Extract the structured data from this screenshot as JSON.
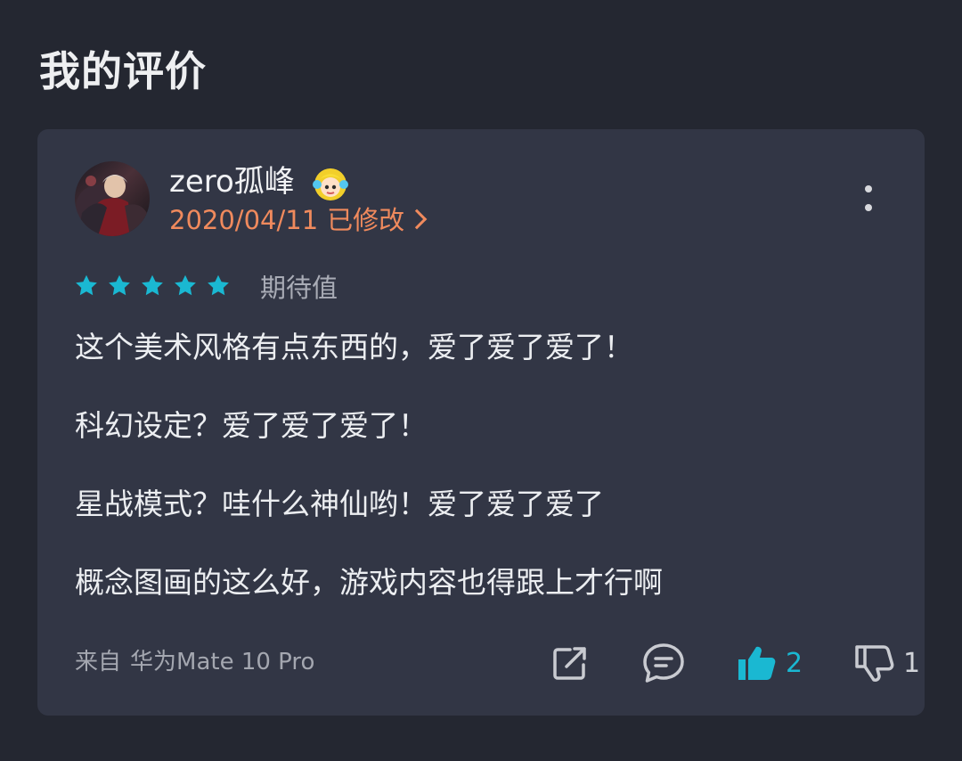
{
  "page": {
    "title": "我的评价"
  },
  "review": {
    "username": "zero孤峰",
    "date": "2020/04/11",
    "edited_label": "已修改",
    "rating_stars": 5,
    "rating_label": "期待值",
    "paragraphs": [
      "这个美术风格有点东西的，爱了爱了爱了！",
      "科幻设定？爱了爱了爱了！",
      "星战模式？哇什么神仙哟！爱了爱了爱了",
      "概念图画的这么好，游戏内容也得跟上才行啊"
    ],
    "device_prefix": "来自",
    "device_model": "华为Mate 10 Pro",
    "likes": "2",
    "dislikes": "1"
  },
  "icons": {
    "avatar": "avatar-image",
    "badge": "anime-girl-badge-icon",
    "chevron": "chevron-right-icon",
    "more": "more-vertical-icon",
    "star": "star-icon",
    "share": "share-icon",
    "comment": "comment-icon",
    "like": "thumbs-up-icon",
    "dislike": "thumbs-down-icon"
  },
  "colors": {
    "background": "#242731",
    "card": "#323645",
    "accent": "#1ab8d2",
    "date": "#f08a5d",
    "muted": "#a4a7b0"
  }
}
